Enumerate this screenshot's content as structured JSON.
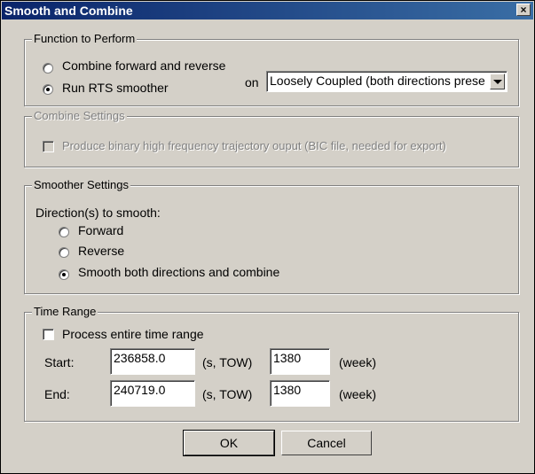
{
  "window": {
    "title": "Smooth and Combine",
    "close_label": "×"
  },
  "function_group": {
    "legend": "Function to Perform",
    "combine_label": "Combine forward and reverse",
    "rts_label": "Run RTS smoother",
    "selected": "rts",
    "on_label": "on",
    "coupling_value": "Loosely Coupled (both directions prese"
  },
  "combine_group": {
    "legend": "Combine Settings",
    "bic_label": "Produce binary high frequency trajectory ouput (BIC file, needed for export)",
    "bic_checked": false
  },
  "smoother_group": {
    "legend": "Smoother Settings",
    "direction_label": "Direction(s) to smooth:",
    "forward_label": "Forward",
    "reverse_label": "Reverse",
    "both_label": "Smooth both directions and combine",
    "selected": "both"
  },
  "time_group": {
    "legend": "Time Range",
    "entire_label": "Process entire time range",
    "entire_checked": false,
    "start_label": "Start:",
    "start_tow": "236858.0",
    "start_week": "1380",
    "end_label": "End:",
    "end_tow": "240719.0",
    "end_week": "1380",
    "tow_unit": "(s, TOW)",
    "week_unit": "(week)"
  },
  "buttons": {
    "ok_label": "OK",
    "cancel_label": "Cancel"
  },
  "colors": {
    "titlebar_start": "#0a246a",
    "titlebar_end": "#3a6ea5",
    "face": "#d4d0c8"
  }
}
